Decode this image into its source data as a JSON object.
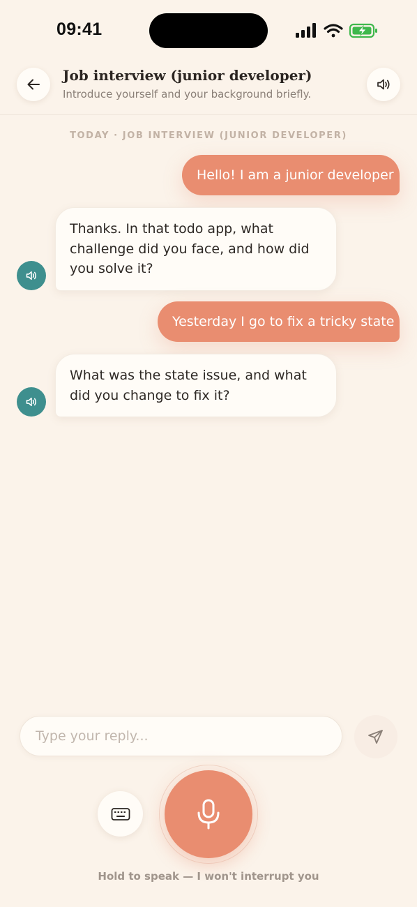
{
  "status_bar": {
    "time": "09:41",
    "icons": [
      "signal-icon",
      "wifi-icon",
      "battery-charging-icon"
    ],
    "battery_color": "#3fb84c"
  },
  "header": {
    "title": "Job interview (junior developer)",
    "subtitle": "Introduce yourself and your background briefly.",
    "back_icon": "arrow-left-icon",
    "sound_icon": "speaker-icon"
  },
  "chat": {
    "date_separator": "TODAY · JOB INTERVIEW (JUNIOR DEVELOPER)",
    "messages": [
      {
        "role": "user",
        "text": "Hello! I am a junior developer"
      },
      {
        "role": "assistant",
        "text": "Thanks. In that todo app, what challenge did you face, and how did you solve it?"
      },
      {
        "role": "user",
        "text": "Yesterday I go to fix a tricky state"
      },
      {
        "role": "assistant",
        "text": "What was the state issue, and what did you change to fix it?"
      }
    ]
  },
  "composer": {
    "placeholder": "Type your reply...",
    "send_icon": "send-icon",
    "keyboard_icon": "keyboard-icon",
    "mic_icon": "microphone-icon",
    "hint": "Hold to speak — I won't interrupt you"
  },
  "colors": {
    "background": "#fbf3ea",
    "accent": "#e98d70",
    "teal": "#3e8f8e",
    "bubble": "#fffcf7"
  }
}
